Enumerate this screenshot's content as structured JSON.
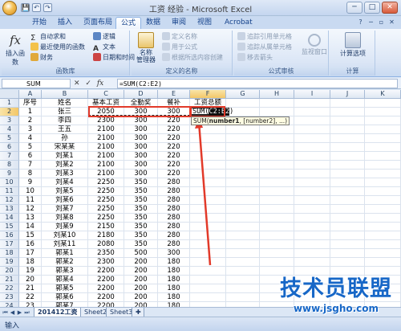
{
  "window": {
    "title": "工资 经验 - Microsoft Excel",
    "controls": {
      "minimize": "─",
      "maximize": "□",
      "close": "✕"
    }
  },
  "qat": {
    "save": "💾",
    "undo": "↶",
    "redo": "↷"
  },
  "tabs": [
    {
      "label": "开始"
    },
    {
      "label": "插入"
    },
    {
      "label": "页面布局"
    },
    {
      "label": "公式"
    },
    {
      "label": "数据"
    },
    {
      "label": "审阅"
    },
    {
      "label": "视图"
    },
    {
      "label": "Acrobat"
    }
  ],
  "active_tab": "公式",
  "ribbon": {
    "insert_function": {
      "icon": "fx",
      "label": "插入函数"
    },
    "library_items": [
      "自动求和",
      "最近使用的函数",
      "财务",
      "逻辑",
      "文本",
      "日期和时间"
    ],
    "library_label": "函数库",
    "name_manager": "名称\n管理器",
    "names_items": [
      "定义名称",
      "用于公式",
      "根据所选内容创建"
    ],
    "names_label": "定义的名称",
    "audit_items": [
      "追踪引用单元格",
      "追踪从属单元格",
      "移去箭头"
    ],
    "audit_label": "公式审核",
    "watch_window": "监视窗口",
    "calc_options": "计算选项",
    "calc_label": "计算"
  },
  "formula_bar": {
    "name_box": "SUM",
    "cancel": "✕",
    "enter": "✓",
    "fx": "fx",
    "formula": "=SUM(C2:E2)"
  },
  "columns": [
    "A",
    "B",
    "C",
    "D",
    "E",
    "F",
    "G",
    "H",
    "I",
    "J",
    "K"
  ],
  "rows": [
    [
      "序号",
      "姓名",
      "基本工资",
      "全勤奖",
      "餐补",
      "工资总额"
    ],
    [
      "1",
      "张三",
      "2050",
      "300",
      "300",
      ""
    ],
    [
      "2",
      "李四",
      "2300",
      "300",
      "220",
      ""
    ],
    [
      "3",
      "王五",
      "2100",
      "300",
      "220",
      ""
    ],
    [
      "4",
      "孙",
      "2100",
      "300",
      "220",
      ""
    ],
    [
      "5",
      "宋某某",
      "2100",
      "300",
      "220",
      ""
    ],
    [
      "6",
      "刘某1",
      "2100",
      "300",
      "220",
      ""
    ],
    [
      "7",
      "刘某2",
      "2100",
      "300",
      "220",
      ""
    ],
    [
      "8",
      "刘某3",
      "2100",
      "300",
      "220",
      ""
    ],
    [
      "9",
      "刘某4",
      "2250",
      "350",
      "280",
      ""
    ],
    [
      "10",
      "刘某5",
      "2250",
      "350",
      "280",
      ""
    ],
    [
      "11",
      "刘某6",
      "2250",
      "350",
      "280",
      ""
    ],
    [
      "12",
      "刘某7",
      "2250",
      "350",
      "280",
      ""
    ],
    [
      "13",
      "刘某8",
      "2250",
      "350",
      "280",
      ""
    ],
    [
      "14",
      "刘某9",
      "2150",
      "350",
      "280",
      ""
    ],
    [
      "15",
      "刘某10",
      "2180",
      "350",
      "280",
      ""
    ],
    [
      "16",
      "刘某11",
      "2080",
      "350",
      "280",
      ""
    ],
    [
      "17",
      "郭某1",
      "2350",
      "500",
      "300",
      ""
    ],
    [
      "18",
      "郭某2",
      "2300",
      "200",
      "180",
      ""
    ],
    [
      "19",
      "郭某3",
      "2200",
      "200",
      "180",
      ""
    ],
    [
      "20",
      "郭某4",
      "2200",
      "200",
      "180",
      ""
    ],
    [
      "21",
      "郭某5",
      "2200",
      "200",
      "180",
      ""
    ],
    [
      "22",
      "郭某6",
      "2200",
      "200",
      "180",
      ""
    ],
    [
      "23",
      "郭某7",
      "2200",
      "200",
      "180",
      ""
    ]
  ],
  "edit_cell": {
    "prefix": "SUM(",
    "range": "C2:E2",
    "suffix": ")"
  },
  "tooltip": {
    "fn": "SUM(",
    "arg1": "number1",
    "rest": ", [number2], ...)"
  },
  "sheet_tabs": [
    "201412工资",
    "Sheet2",
    "Sheet3"
  ],
  "active_sheet": "201412工资",
  "status": "输入",
  "watermark": {
    "title": "技术员联盟",
    "url": "www.jsgho.com"
  },
  "colors": {
    "accent_red": "#e23a2a",
    "ribbon_blue": "#15428b",
    "watermark_blue": "#1767c7"
  }
}
